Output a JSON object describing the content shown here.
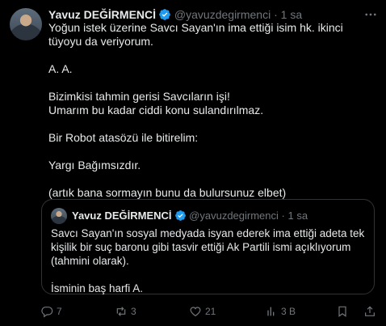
{
  "tweet": {
    "author_name": "Yavuz DEĞİRMENCİ",
    "handle": "@yavuzdegirmenci",
    "separator": "·",
    "time": "1 sa",
    "lines": [
      "Yoğun istek üzerine Savcı Sayan'ın ima ettiği isim hk. ikinci tüyoyu da veriyorum.",
      "A. A.",
      "Bizimkisi tahmin gerisi Savcıların işi!",
      "Umarım bu kadar ciddi konu sulandırılmaz.",
      "Bir Robot atasözü ile bitirelim:",
      "Yargı Bağımsızdır.",
      "(artık bana sormayın bunu da bulursunuz elbet)"
    ]
  },
  "quote": {
    "author_name": "Yavuz DEĞİRMENCİ",
    "handle": "@yavuzdegirmenci",
    "separator": "·",
    "time": "1 sa",
    "text": "Savcı Sayan'ın sosyal medyada isyan ederek ima ettiği adeta tek kişilik bir suç baronu gibi tasvir ettiği Ak Partili ismi açıklıyorum (tahmini olarak).",
    "text2": "İsminin baş harfi A."
  },
  "actions": {
    "replies": "7",
    "reposts": "3",
    "likes": "21",
    "views": "3 B"
  },
  "icons": {
    "verified": "verified-badge-icon",
    "more": "more-icon",
    "reply": "reply-icon",
    "repost": "repost-icon",
    "like": "heart-icon",
    "views": "views-icon",
    "bookmark": "bookmark-icon",
    "share": "share-icon"
  },
  "colors": {
    "background": "#000000",
    "text": "#e7e9ea",
    "secondary": "#71767b",
    "verified": "#1d9bf0",
    "border": "#2f3336"
  }
}
